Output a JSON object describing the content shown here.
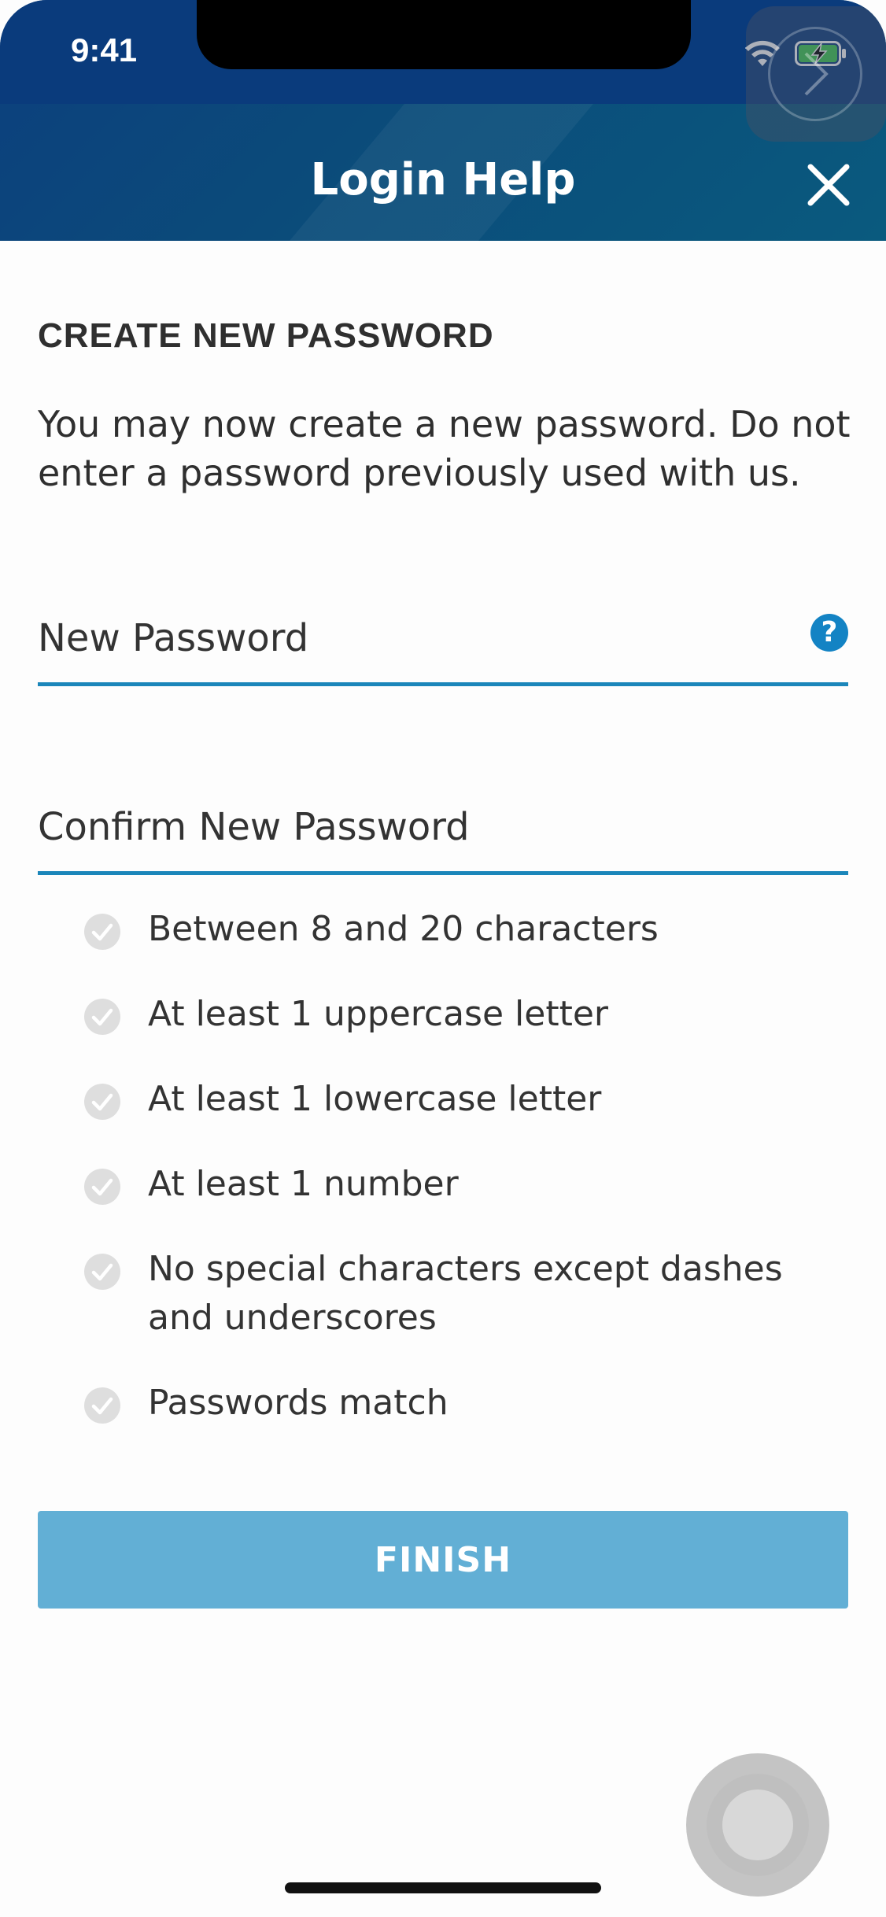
{
  "status_bar": {
    "time": "9:41",
    "icons": [
      "wifi-icon",
      "battery-charging-icon"
    ]
  },
  "header": {
    "title": "Login Help",
    "close_icon": "close-icon"
  },
  "content": {
    "heading": "CREATE NEW PASSWORD",
    "intro": "You may now create a new password. Do not enter a password previously used with us.",
    "fields": {
      "new_password_label": "New Password",
      "confirm_password_label": "Confirm New Password",
      "help_icon_glyph": "?"
    },
    "rules": [
      "Between 8 and 20 characters",
      "At least 1 uppercase letter",
      "At least 1 lowercase letter",
      "At least 1 number",
      "No special characters except dashes and underscores",
      "Passwords match"
    ],
    "finish_label": "FINISH"
  },
  "colors": {
    "header_bg": "#0b4a7a",
    "accent": "#1b86ba",
    "help_icon": "#1383c4",
    "button_disabled": "#62afd5",
    "check_inactive": "#cfcfcf"
  }
}
